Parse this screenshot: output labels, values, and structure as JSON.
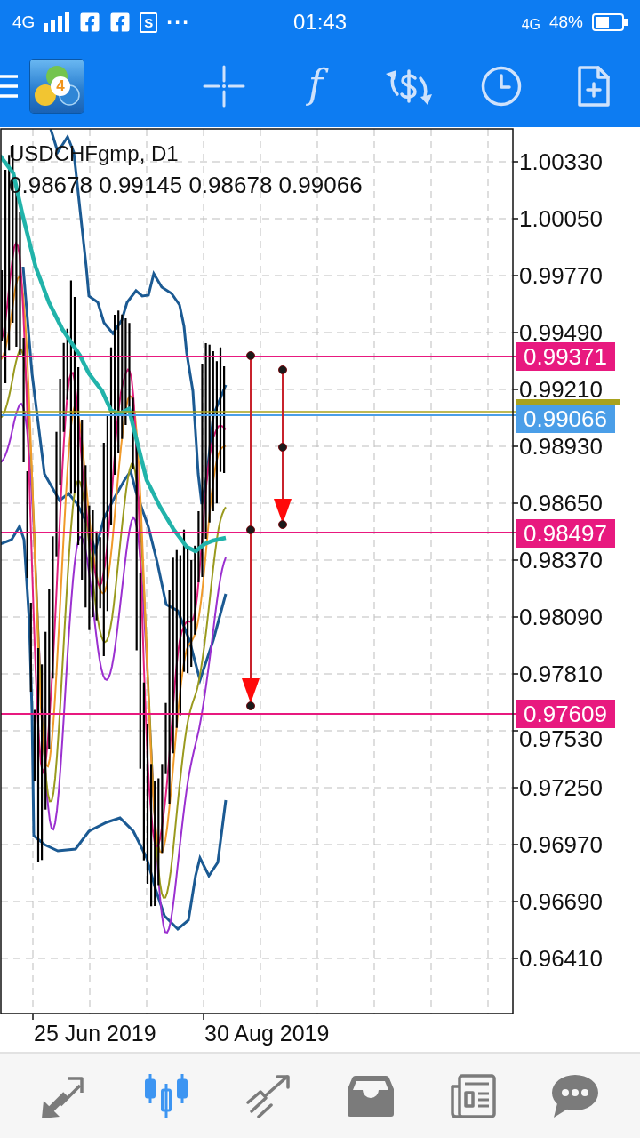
{
  "status_bar": {
    "network": "4G",
    "notifications": [
      {
        "kind": "facebook"
      },
      {
        "kind": "facebook"
      },
      {
        "kind": "letter",
        "glyph": "S"
      }
    ],
    "more": "···",
    "time": "01:43",
    "network_right": "4G",
    "battery": "48%"
  },
  "toolbar": {
    "logo_badge": "4",
    "tools": [
      {
        "kind": "crosshair"
      },
      {
        "kind": "glyph",
        "glyph": "f"
      },
      {
        "kind": "dollar"
      },
      {
        "kind": "clock"
      },
      {
        "kind": "document"
      }
    ]
  },
  "chart": {
    "symbol": "USDCHFgmp, D1",
    "ohlc": "0.98678 0.99145 0.98678 0.99066",
    "price_axis": [
      "1.00330",
      "1.00050",
      "0.99770",
      "0.99490",
      "0.99210",
      "0.98930",
      "0.98650",
      "0.98370",
      "0.98090",
      "0.97810",
      "0.97530",
      "0.97250",
      "0.96970",
      "0.96690",
      "0.96410"
    ],
    "date_axis": [
      "25 Jun 2019",
      "30 Aug 2019"
    ],
    "levels": [
      {
        "label": "0.99371",
        "color": "#e8197f"
      },
      {
        "label": "0.99066",
        "color": "#4a9ee8"
      },
      {
        "label": "0.98497",
        "color": "#e8197f"
      },
      {
        "label": "0.97609",
        "color": "#e8197f"
      }
    ]
  },
  "bottom_nav": [
    {
      "kind": "arrows",
      "selected": false
    },
    {
      "kind": "candles",
      "selected": true
    },
    {
      "kind": "trend",
      "selected": false
    },
    {
      "kind": "tray",
      "selected": false
    },
    {
      "kind": "newspaper",
      "selected": false
    },
    {
      "kind": "bubble",
      "selected": false
    }
  ]
}
